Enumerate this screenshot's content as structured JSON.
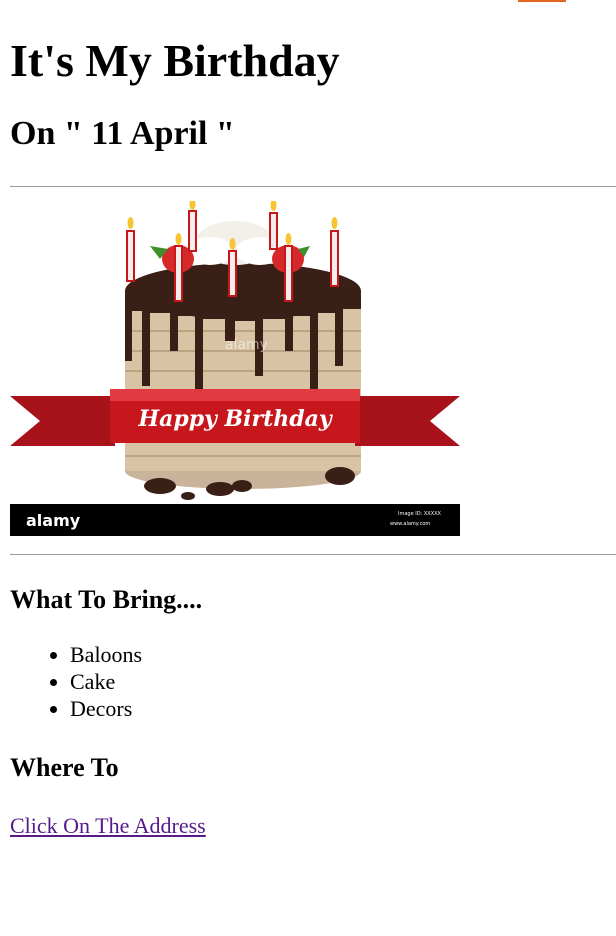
{
  "title": "It's My Birthday",
  "date_line": "On \" 11 April \"",
  "cake_image": {
    "ribbon_text": "Happy Birthday",
    "watermark": "alamy",
    "footer_brand": "alamy",
    "footer_small": "www.alamy.com",
    "footer_code": "Image ID: XXXXX"
  },
  "bring": {
    "heading": "What To Bring....",
    "items": [
      "Baloons",
      "Cake",
      "Decors"
    ]
  },
  "where": {
    "heading": "Where To",
    "link_text": "Click On The Address"
  },
  "colors": {
    "link_visited": "#551a8b",
    "ribbon": "#c8161d",
    "chocolate": "#3a1f17",
    "accent": "#e2661f"
  }
}
